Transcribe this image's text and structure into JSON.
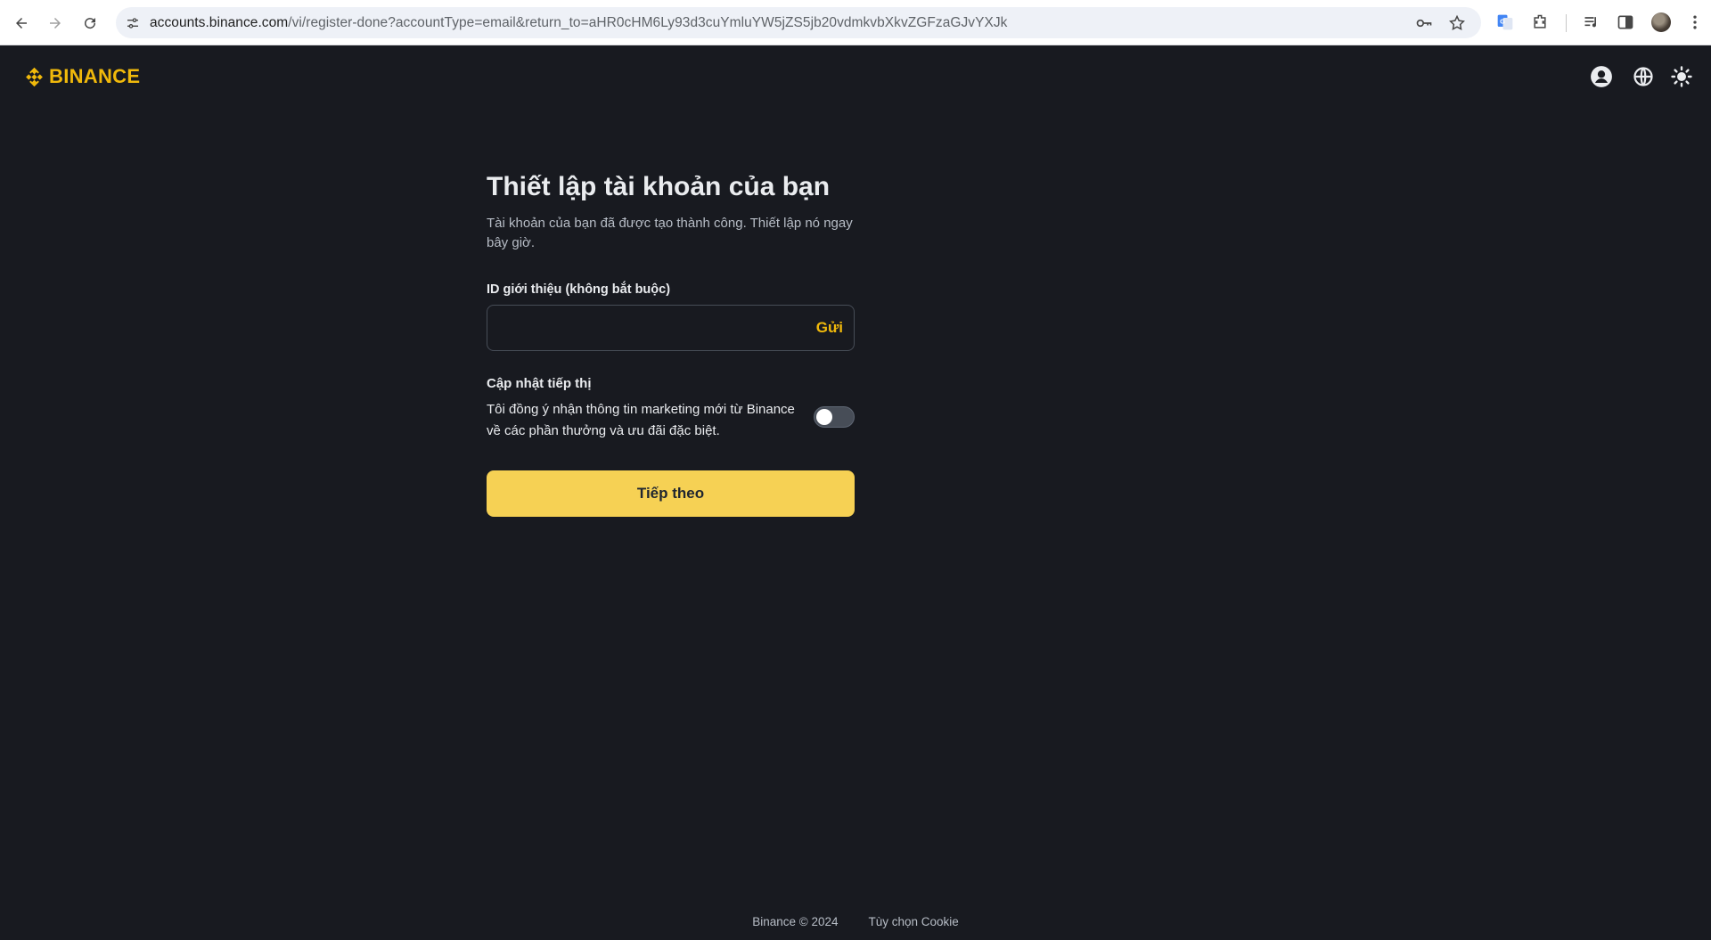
{
  "browser": {
    "url_host": "accounts.binance.com",
    "url_path": "/vi/register-done?accountType=email&return_to=aHR0cHM6Ly93d3cuYmluYW5jZS5jb20vdmkvbXkvZGFzaGJvYXJk",
    "icons": [
      "back-icon",
      "forward-icon",
      "reload-icon",
      "site-settings-icon",
      "password-key-icon",
      "bookmark-star-icon",
      "google-translate-icon",
      "extensions-icon",
      "media-control-icon",
      "side-panel-icon",
      "profile-avatar",
      "more-menu-icon"
    ]
  },
  "header": {
    "logo_text": "BINANCE",
    "icons": [
      "account-icon",
      "language-globe-icon",
      "theme-sun-icon"
    ]
  },
  "form": {
    "title": "Thiết lập tài khoản của bạn",
    "subtitle": "Tài khoản của bạn đã được tạo thành công. Thiết lập nó ngay bây giờ.",
    "referral_label": "ID giới thiệu (không bắt buộc)",
    "referral_value": "",
    "send_label": "Gửi",
    "marketing_title": "Cập nhật tiếp thị",
    "marketing_text": "Tôi đồng ý nhận thông tin marketing mới từ Binance về các phần thưởng và ưu đãi đặc biệt.",
    "marketing_opt_in": false,
    "next_label": "Tiếp theo"
  },
  "footer": {
    "copyright": "Binance © 2024",
    "cookie_link": "Tùy chọn Cookie"
  },
  "colors": {
    "background": "#181a20",
    "brand_yellow": "#f0b90b",
    "button_yellow": "#f6d154",
    "text_primary": "#eaecef",
    "text_secondary": "#b7bdc6",
    "border": "#474d57"
  }
}
